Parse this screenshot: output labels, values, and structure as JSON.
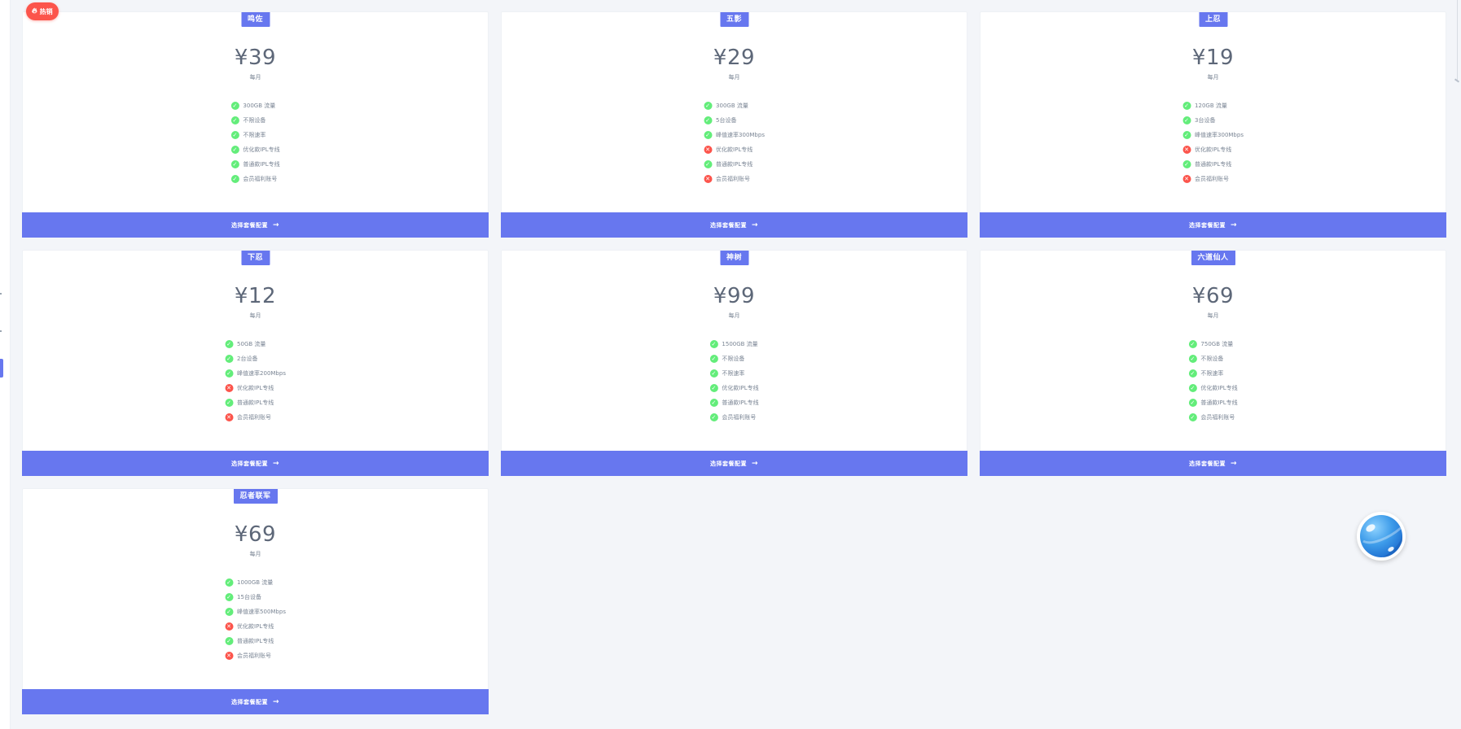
{
  "colors": {
    "primary": "#6777ef",
    "success": "#63ed7a",
    "danger": "#fc544b",
    "background": "#f3f5f9"
  },
  "hot_badge": {
    "icon": "fire-icon",
    "label": "热销"
  },
  "plans": [
    {
      "tier": "鸣佐",
      "price": "¥39",
      "period": "每月",
      "cta": "选择套餐配置",
      "features": [
        {
          "text": "300GB 流量",
          "included": true
        },
        {
          "text": "不限设备",
          "included": true
        },
        {
          "text": "不限速率",
          "included": true
        },
        {
          "text": "优化款IPL专线",
          "included": true
        },
        {
          "text": "普通款IPL专线",
          "included": true
        },
        {
          "text": "会员福利账号",
          "included": true
        }
      ]
    },
    {
      "tier": "五影",
      "price": "¥29",
      "period": "每月",
      "cta": "选择套餐配置",
      "features": [
        {
          "text": "300GB 流量",
          "included": true
        },
        {
          "text": "5台设备",
          "included": true
        },
        {
          "text": "峰值速率300Mbps",
          "included": true
        },
        {
          "text": "优化款IPL专线",
          "included": false
        },
        {
          "text": "普通款IPL专线",
          "included": true
        },
        {
          "text": "会员福利账号",
          "included": false
        }
      ]
    },
    {
      "tier": "上忍",
      "price": "¥19",
      "period": "每月",
      "cta": "选择套餐配置",
      "features": [
        {
          "text": "120GB 流量",
          "included": true
        },
        {
          "text": "3台设备",
          "included": true
        },
        {
          "text": "峰值速率300Mbps",
          "included": true
        },
        {
          "text": "优化款IPL专线",
          "included": false
        },
        {
          "text": "普通款IPL专线",
          "included": true
        },
        {
          "text": "会员福利账号",
          "included": false
        }
      ]
    },
    {
      "tier": "下忍",
      "price": "¥12",
      "period": "每月",
      "cta": "选择套餐配置",
      "features": [
        {
          "text": "50GB 流量",
          "included": true
        },
        {
          "text": "2台设备",
          "included": true
        },
        {
          "text": "峰值速率200Mbps",
          "included": true
        },
        {
          "text": "优化款IPL专线",
          "included": false
        },
        {
          "text": "普通款IPL专线",
          "included": true
        },
        {
          "text": "会员福利账号",
          "included": false
        }
      ]
    },
    {
      "tier": "神树",
      "price": "¥99",
      "period": "每月",
      "cta": "选择套餐配置",
      "features": [
        {
          "text": "1500GB 流量",
          "included": true
        },
        {
          "text": "不限设备",
          "included": true
        },
        {
          "text": "不限速率",
          "included": true
        },
        {
          "text": "优化款IPL专线",
          "included": true
        },
        {
          "text": "普通款IPL专线",
          "included": true
        },
        {
          "text": "会员福利账号",
          "included": true
        }
      ]
    },
    {
      "tier": "六道仙人",
      "price": "¥69",
      "period": "每月",
      "cta": "选择套餐配置",
      "features": [
        {
          "text": "750GB 流量",
          "included": true
        },
        {
          "text": "不限设备",
          "included": true
        },
        {
          "text": "不限速率",
          "included": true
        },
        {
          "text": "优化款IPL专线",
          "included": true
        },
        {
          "text": "普通款IPL专线",
          "included": true
        },
        {
          "text": "会员福利账号",
          "included": true
        }
      ]
    },
    {
      "tier": "忍者联军",
      "price": "¥69",
      "period": "每月",
      "cta": "选择套餐配置",
      "features": [
        {
          "text": "1000GB 流量",
          "included": true
        },
        {
          "text": "15台设备",
          "included": true
        },
        {
          "text": "峰值速率500Mbps",
          "included": true
        },
        {
          "text": "优化款IPL专线",
          "included": false
        },
        {
          "text": "普通款IPL专线",
          "included": true
        },
        {
          "text": "会员福利账号",
          "included": false
        }
      ]
    }
  ],
  "chat_widget": {
    "icon": "chat-planet-icon"
  }
}
